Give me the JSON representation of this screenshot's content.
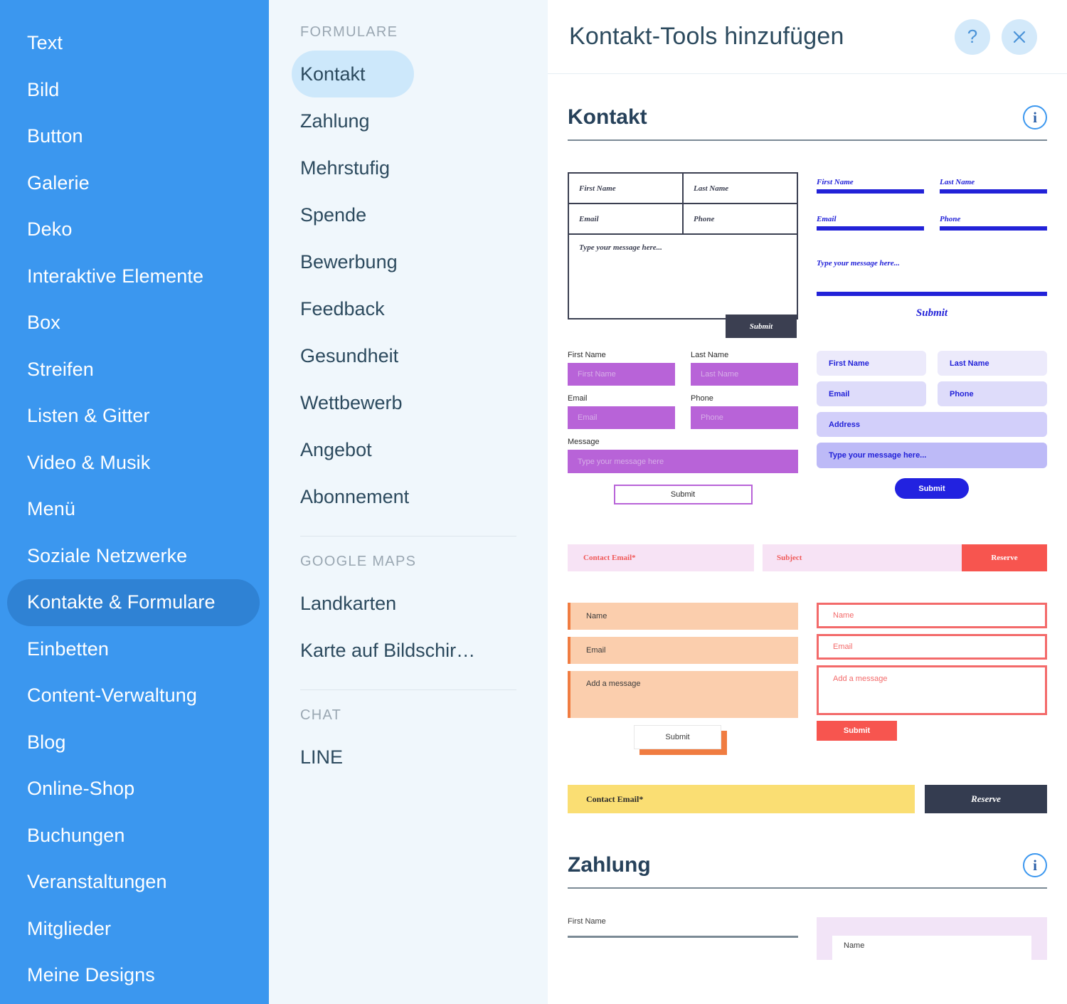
{
  "sidebar": {
    "items": [
      {
        "label": "Text",
        "selected": false
      },
      {
        "label": "Bild",
        "selected": false
      },
      {
        "label": "Button",
        "selected": false
      },
      {
        "label": "Galerie",
        "selected": false
      },
      {
        "label": "Deko",
        "selected": false
      },
      {
        "label": "Interaktive Elemente",
        "selected": false
      },
      {
        "label": "Box",
        "selected": false
      },
      {
        "label": "Streifen",
        "selected": false
      },
      {
        "label": "Listen & Gitter",
        "selected": false
      },
      {
        "label": "Video & Musik",
        "selected": false
      },
      {
        "label": "Menü",
        "selected": false
      },
      {
        "label": "Soziale Netzwerke",
        "selected": false
      },
      {
        "label": "Kontakte & Formulare",
        "selected": true
      },
      {
        "label": "Einbetten",
        "selected": false
      },
      {
        "label": "Content-Verwaltung",
        "selected": false
      },
      {
        "label": "Blog",
        "selected": false
      },
      {
        "label": "Online-Shop",
        "selected": false
      },
      {
        "label": "Buchungen",
        "selected": false
      },
      {
        "label": "Veranstaltungen",
        "selected": false
      },
      {
        "label": "Mitglieder",
        "selected": false
      },
      {
        "label": "Meine Designs",
        "selected": false
      }
    ]
  },
  "subnav": {
    "groups": [
      {
        "heading": "FORMULARE",
        "items": [
          {
            "label": "Kontakt",
            "selected": true
          },
          {
            "label": "Zahlung",
            "selected": false
          },
          {
            "label": "Mehrstufig",
            "selected": false
          },
          {
            "label": "Spende",
            "selected": false
          },
          {
            "label": "Bewerbung",
            "selected": false
          },
          {
            "label": "Feedback",
            "selected": false
          },
          {
            "label": "Gesundheit",
            "selected": false
          },
          {
            "label": "Wettbewerb",
            "selected": false
          },
          {
            "label": "Angebot",
            "selected": false
          },
          {
            "label": "Abonnement",
            "selected": false
          }
        ]
      },
      {
        "heading": "GOOGLE MAPS",
        "items": [
          {
            "label": "Landkarten",
            "selected": false
          },
          {
            "label": "Karte auf Bildschir…",
            "selected": false
          }
        ]
      },
      {
        "heading": "CHAT",
        "items": [
          {
            "label": "LINE",
            "selected": false
          }
        ]
      }
    ]
  },
  "header": {
    "title": "Kontakt-Tools hinzufügen",
    "help_label": "?",
    "close_label": "×"
  },
  "sections": {
    "kontakt": {
      "title": "Kontakt",
      "info_label": "i"
    },
    "zahlung": {
      "title": "Zahlung",
      "info_label": "i"
    }
  },
  "templates": {
    "t1": {
      "first_name": "First Name",
      "last_name": "Last Name",
      "email": "Email",
      "phone": "Phone",
      "message": "Type your message here...",
      "submit": "Submit"
    },
    "t2": {
      "first_name": "First Name",
      "last_name": "Last Name",
      "email": "Email",
      "phone": "Phone",
      "message": "Type your message here...",
      "submit": "Submit"
    },
    "t3": {
      "first_name_label": "First Name",
      "first_name_ph": "First Name",
      "last_name_label": "Last Name",
      "last_name_ph": "Last Name",
      "email_label": "Email",
      "email_ph": "Email",
      "phone_label": "Phone",
      "phone_ph": "Phone",
      "message_label": "Message",
      "message_ph": "Type your message here",
      "submit": "Submit"
    },
    "t4": {
      "first_name": "First Name",
      "last_name": "Last Name",
      "email": "Email",
      "phone": "Phone",
      "address": "Address",
      "message": "Type your message here...",
      "submit": "Submit"
    },
    "t5": {
      "contact_email": "Contact Email*",
      "subject": "Subject",
      "reserve": "Reserve"
    },
    "t6": {
      "name": "Name",
      "email": "Email",
      "message": "Add a message",
      "submit": "Submit"
    },
    "t7": {
      "name": "Name",
      "email": "Email",
      "message": "Add a message",
      "submit": "Submit"
    },
    "t8": {
      "contact_email": "Contact Email*",
      "reserve": "Reserve"
    },
    "zahlung": {
      "first_name": "First Name",
      "card_name": "Name"
    }
  },
  "colors": {
    "sidebar_blue": "#3b97ef",
    "sidebar_selected": "#2f82d4",
    "subnav_bg": "#f0f7fc",
    "subnav_selected": "#cde8fb",
    "title_ink": "#2c4a5e",
    "navy": "#3b3f51",
    "blue_accent": "#2222d8",
    "purple": "#b863d8",
    "lavender": "#c9c9f7",
    "pink": "#f7e3f5",
    "red": "#f7554f",
    "peach": "#fbcead",
    "orange": "#f07c41",
    "yellow": "#fade73"
  }
}
